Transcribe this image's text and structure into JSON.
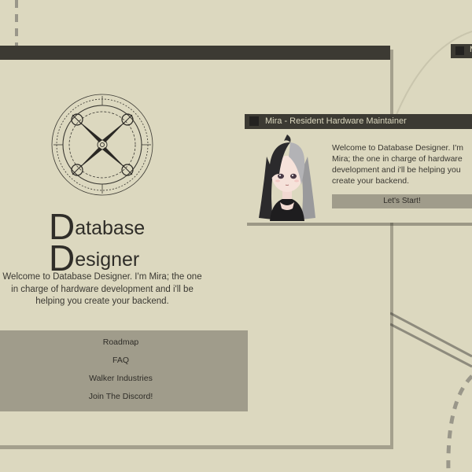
{
  "background": {
    "color": "#dcd8bf",
    "accent": "#3c3a33",
    "panel": "#a09c8b"
  },
  "main_window": {
    "brand": {
      "first_cap": "D",
      "first_rest": "atabase",
      "second_cap": "D",
      "second_rest": "esigner"
    },
    "welcome_text": "Welcome to Database Designer. I'm Mira; the one in charge of hardware development and i'll be helping you create your backend.",
    "menu": [
      {
        "label": "Roadmap"
      },
      {
        "label": "FAQ"
      },
      {
        "label": "Walker Industries"
      },
      {
        "label": "Join The Discord!"
      }
    ],
    "logo_icon": "compass-sigil-icon"
  },
  "dialog": {
    "title": "Mira - Resident Hardware Maintainer",
    "message": "Welcome to Database Designer. I'm Mira; the one in charge of hardware development and i'll be helping you create your backend.",
    "button_label": "Let's Start!",
    "avatar_icon": "mira-avatar"
  },
  "corner_window": {
    "title_fragment": "M"
  }
}
